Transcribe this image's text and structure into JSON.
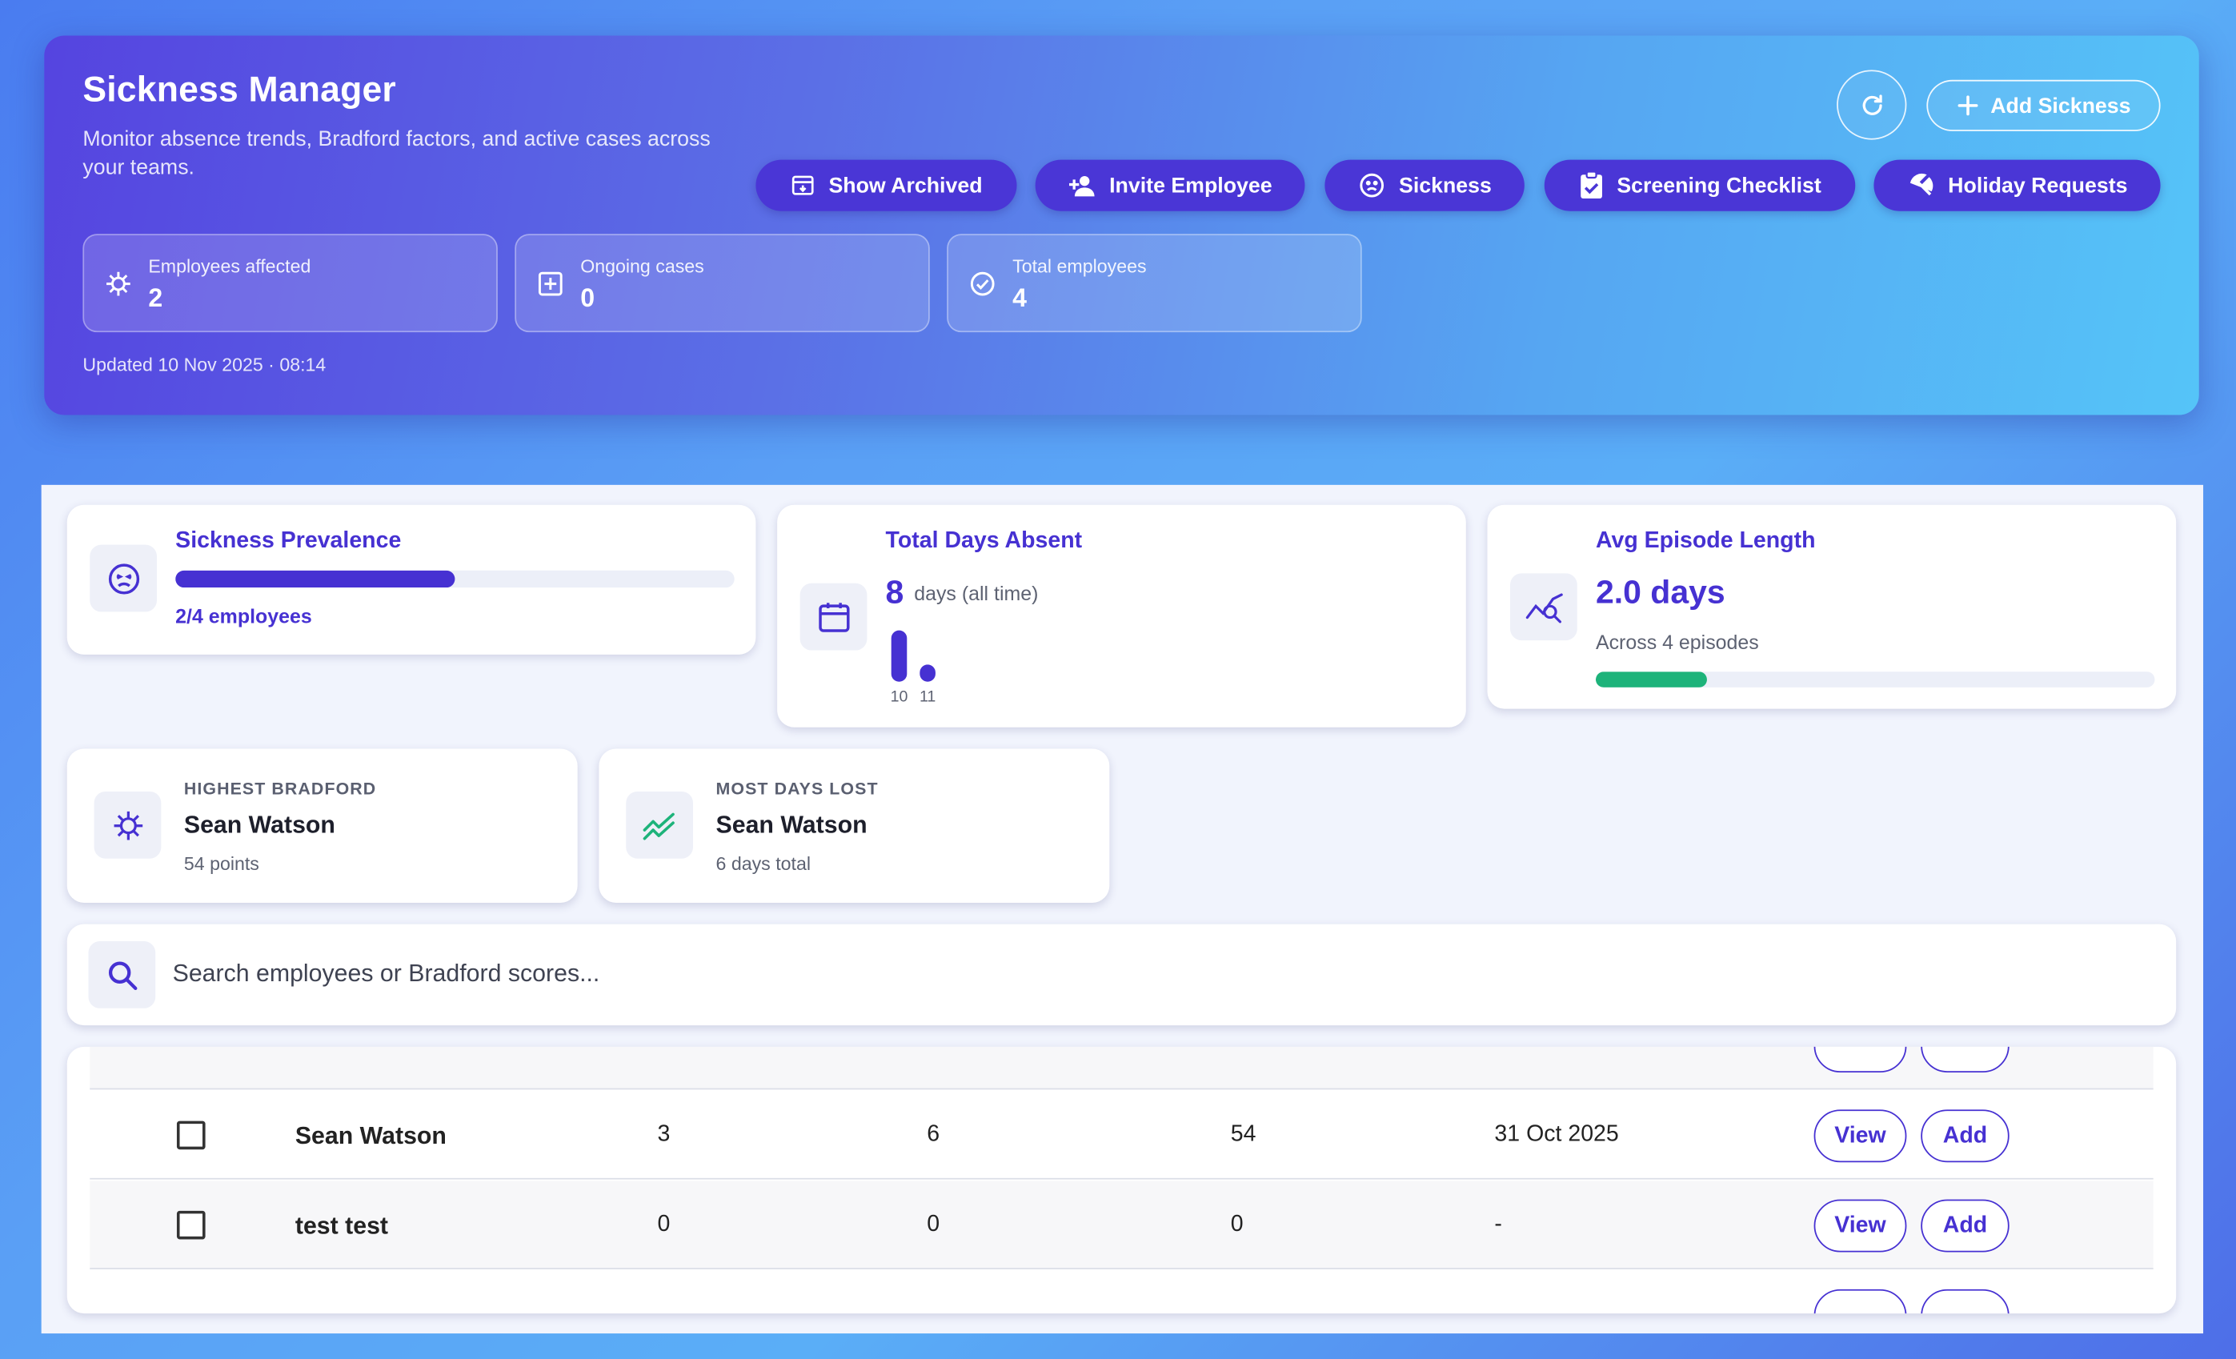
{
  "header": {
    "title": "Sickness Manager",
    "subtitle": "Monitor absence trends, Bradford factors, and active cases across your teams.",
    "updated": "Updated 10 Nov 2025 · 08:14",
    "add_button": "Add Sickness"
  },
  "actions": [
    {
      "label": "Show Archived",
      "icon": "archive-icon"
    },
    {
      "label": "Invite Employee",
      "icon": "person-add-icon"
    },
    {
      "label": "Sickness",
      "icon": "sick-face-icon"
    },
    {
      "label": "Screening Checklist",
      "icon": "clipboard-check-icon"
    },
    {
      "label": "Holiday Requests",
      "icon": "beach-umbrella-icon"
    }
  ],
  "stats": [
    {
      "label": "Employees affected",
      "value": "2",
      "icon": "virus-icon"
    },
    {
      "label": "Ongoing cases",
      "value": "0",
      "icon": "medical-plus-icon"
    },
    {
      "label": "Total employees",
      "value": "4",
      "icon": "check-circle-icon"
    }
  ],
  "prevalence": {
    "title": "Sickness Prevalence",
    "caption": "2/4 employees",
    "fraction": 0.5
  },
  "total_days": {
    "title": "Total Days Absent",
    "value": "8",
    "unit": "days (all time)",
    "spark": [
      {
        "label": "10",
        "value": 6
      },
      {
        "label": "11",
        "value": 2
      }
    ]
  },
  "avg_episode": {
    "title": "Avg Episode Length",
    "value": "2.0 days",
    "caption": "Across 4 episodes",
    "fraction": 0.2
  },
  "highest_bradford": {
    "label": "HIGHEST BRADFORD",
    "name": "Sean Watson",
    "sub": "54 points"
  },
  "most_days": {
    "label": "MOST DAYS LOST",
    "name": "Sean Watson",
    "sub": "6 days total"
  },
  "search": {
    "placeholder": "Search employees or Bradford scores..."
  },
  "rows": [
    {
      "name": "Sean Watson",
      "episodes": "3",
      "days": "6",
      "bradford": "54",
      "last": "31 Oct 2025",
      "view": "View",
      "add": "Add"
    },
    {
      "name": "test test",
      "episodes": "0",
      "days": "0",
      "bradford": "0",
      "last": "-",
      "view": "View",
      "add": "Add"
    }
  ],
  "colors": {
    "accent": "#4631d2",
    "green": "#1db37a"
  }
}
